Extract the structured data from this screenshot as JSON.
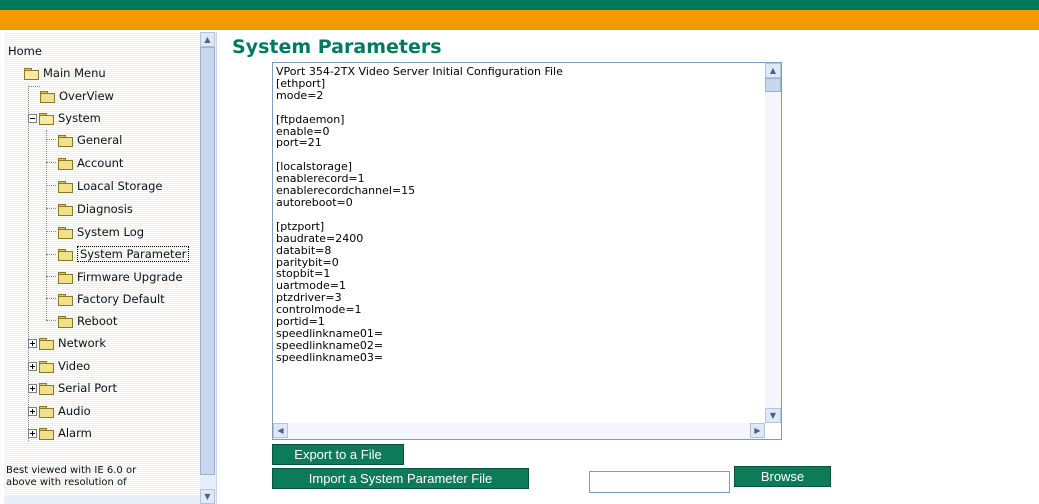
{
  "sidebar": {
    "home": "Home",
    "main_menu": "Main Menu",
    "items": {
      "overview": "OverView",
      "system": "System",
      "general": "General",
      "account": "Account",
      "local_storage": "Loacal Storage",
      "diagnosis": "Diagnosis",
      "system_log": "System Log",
      "system_parameter": "System Parameter",
      "firmware_upgrade": "Firmware Upgrade",
      "factory_default": "Factory Default",
      "reboot": "Reboot",
      "network": "Network",
      "video": "Video",
      "serial_port": "Serial Port",
      "audio": "Audio",
      "alarm": "Alarm"
    },
    "footnote_line1": "Best viewed with IE 6.0 or",
    "footnote_line2": "above with resolution of"
  },
  "main": {
    "title": "System Parameters",
    "config_text": "VPort 354-2TX Video Server Initial Configuration File\n[ethport]\nmode=2\n\n[ftpdaemon]\nenable=0\nport=21\n\n[localstorage]\nenablerecord=1\nenablerecordchannel=15\nautoreboot=0\n\n[ptzport]\nbaudrate=2400\ndatabit=8\nparitybit=0\nstopbit=1\nuartmode=1\nptzdriver=3\ncontrolmode=1\nportid=1\nspeedlinkname01=\nspeedlinkname02=\nspeedlinkname03=",
    "export_button": "Export to a File",
    "import_button": "Import a System Parameter File",
    "browse_button": "Browse",
    "file_value": ""
  },
  "colors": {
    "brand_green": "#007a5e",
    "brand_orange": "#f39a00",
    "button_green": "#0d7a58"
  }
}
